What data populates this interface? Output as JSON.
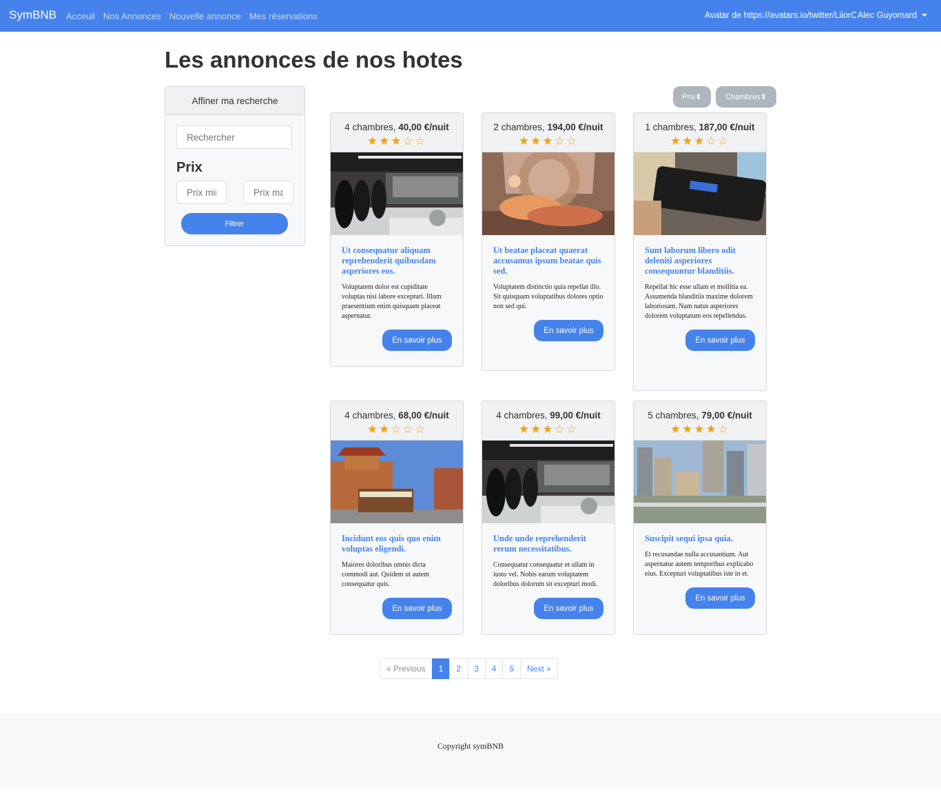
{
  "navbar": {
    "brand": "SymBNB",
    "links": [
      "Acceuil",
      "Nos Annonces",
      "Nouvelle annonce",
      "Mes réservations"
    ],
    "avatar_alt": "Avatar de https://avatars.io/twitter/LiiorC",
    "user_name": "Alec Guyomard"
  },
  "page_title": "Les annonces de nos hotes",
  "sidebar": {
    "header": "Affiner ma recherche",
    "search_placeholder": "Rechercher",
    "prix_title": "Prix",
    "price_min_placeholder": "Prix min",
    "price_max_placeholder": "Prix max",
    "filter_button": "Filtrer"
  },
  "sort": {
    "prix": "Prix⬍",
    "chambres": "Chambres⬍"
  },
  "cards": [
    {
      "rooms": "4 chambres,",
      "price": "40,00 €/nuit",
      "rating": 3,
      "stars": "★★★☆☆",
      "image": "bar-interior",
      "title": "Ut consequatur aliquam reprehenderit quibusdam asperiores eos.",
      "text": "Voluptatem dolor est cupiditate voluptas nisi labore excepturi. Illum praesentium enim quisquam placeat aspernatur.",
      "button": "En savoir plus"
    },
    {
      "rooms": "2 chambres,",
      "price": "194,00 €/nuit",
      "rating": 3,
      "stars": "★★★☆☆",
      "image": "painting-woman",
      "title": "Ut beatae placeat quaerat accusamus ipsum beatae quis sed.",
      "text": "Voluptatem distinctio quia repellat illo. Sit quisquam voluptatibus dolores optio non sed qui.",
      "button": "En savoir plus"
    },
    {
      "rooms": "1 chambres,",
      "price": "187,00 €/nuit",
      "rating": 3,
      "stars": "★★★☆☆",
      "image": "walkman-device",
      "title": "Sunt laborum libero odit deleniti asperiores consequuntur blanditiis.",
      "text": "Repellat hic esse ullam et mollitia ea. Assumenda blanditiis maxime dolorem laboriosam. Nam natus asperiores dolorem voluptatum eos repellendus.",
      "button": "En savoir plus"
    },
    {
      "rooms": "4 chambres,",
      "price": "68,00 €/nuit",
      "rating": 2,
      "stars": "★★☆☆☆",
      "image": "chinatown-tram",
      "title": "Incidunt eos quis quo enim voluptas eligendi.",
      "text": "Maiores doloribus omnis dicta commodi aut. Quidem ut autem consequatur quis.",
      "button": "En savoir plus"
    },
    {
      "rooms": "4 chambres,",
      "price": "99,00 €/nuit",
      "rating": 3,
      "stars": "★★★☆☆",
      "image": "bar-interior",
      "title": "Unde unde reprehenderit rerum necessitatibus.",
      "text": "Consequatur consequatur et ullam in iusto vel. Nobis earum voluptatem doloribus dolorum sit excepturi modi.",
      "button": "En savoir plus"
    },
    {
      "rooms": "5 chambres,",
      "price": "79,00 €/nuit",
      "rating": 4,
      "stars": "★★★★☆",
      "image": "city-skyline",
      "title": "Suscipit sequi ipsa quia.",
      "text": "Et recusandae nulla accusantium. Aut aspernatur autem temporibus explicabo eius. Excepturi voluptatibus iste in et.",
      "button": "En savoir plus"
    }
  ],
  "pagination": {
    "previous": "« Previous",
    "pages": [
      "1",
      "2",
      "3",
      "4",
      "5"
    ],
    "next": "Next »",
    "active": "1"
  },
  "footer": "Copyright symBNB",
  "colors": {
    "primary": "#4582ec",
    "star": "#e8a21b",
    "sort_button": "#adb5bd",
    "footer_bg": "#f7f8f9"
  }
}
